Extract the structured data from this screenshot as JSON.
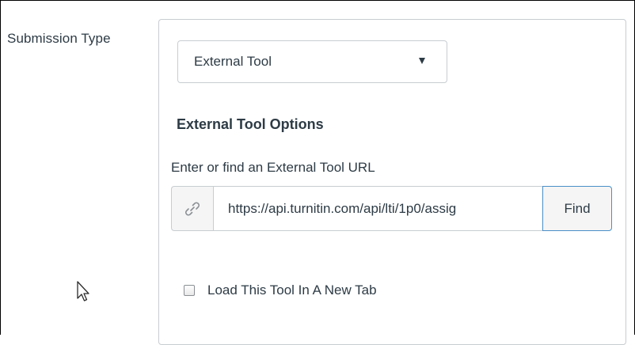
{
  "field": {
    "label": "Submission Type"
  },
  "submission_type_select": {
    "selected": "External Tool"
  },
  "external_tool_options": {
    "title": "External Tool Options",
    "url_label": "Enter or find an External Tool URL",
    "url_value": "https://api.turnitin.com/api/lti/1p0/assig",
    "link_icon": "link-icon",
    "find_label": "Find",
    "new_tab_label": "Load This Tool In A New Tab",
    "new_tab_checked": false
  },
  "colors": {
    "text": "#2d3b45",
    "border": "#c7cdd1",
    "focus_border": "#4a90c8"
  },
  "cursor_icon": "mouse-pointer-icon"
}
